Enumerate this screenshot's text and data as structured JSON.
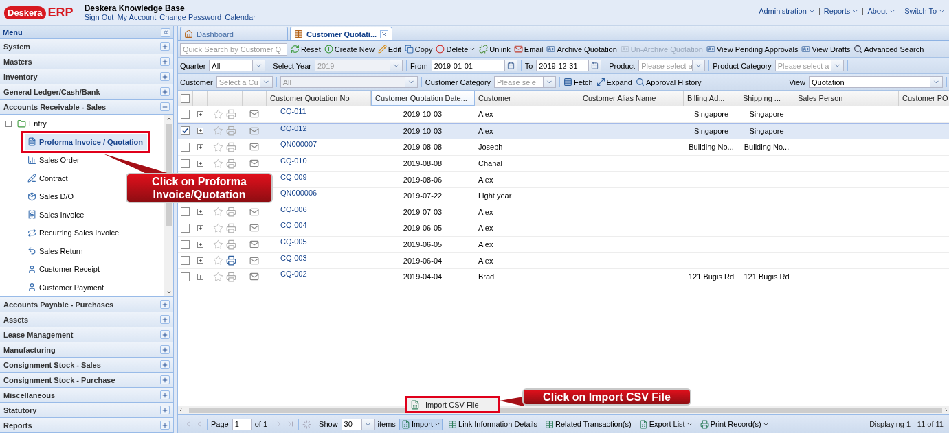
{
  "header": {
    "logo": {
      "word": "Deskera",
      "suffix": "ERP"
    },
    "title": "Deskera Knowledge Base",
    "links": [
      "Sign Out",
      "My Account",
      "Change Password",
      "Calendar"
    ],
    "menus": [
      {
        "label": "Administration"
      },
      {
        "label": "Reports"
      },
      {
        "label": "About"
      },
      {
        "label": "Switch To"
      }
    ]
  },
  "sidebar": {
    "title": "Menu",
    "sections": [
      {
        "label": "System",
        "expanded": false
      },
      {
        "label": "Masters",
        "expanded": false
      },
      {
        "label": "Inventory",
        "expanded": false
      },
      {
        "label": "General Ledger/Cash/Bank",
        "expanded": false
      },
      {
        "label": "Accounts Receivable - Sales",
        "expanded": true,
        "tree": [
          {
            "label": "Entry",
            "expanded": true,
            "children": [
              {
                "label": "Proforma Invoice / Quotation",
                "selected": true,
                "highlighted": true
              },
              {
                "label": "Sales Order",
                "selected": false,
                "highlighted": false
              },
              {
                "label": "Contract",
                "selected": false,
                "highlighted": false
              },
              {
                "label": "Sales D/O",
                "selected": false,
                "highlighted": false
              },
              {
                "label": "Sales Invoice",
                "selected": false,
                "highlighted": false
              },
              {
                "label": "Recurring Sales Invoice",
                "selected": false,
                "highlighted": false
              },
              {
                "label": "Sales Return",
                "selected": false,
                "highlighted": false
              },
              {
                "label": "Customer Receipt",
                "selected": false,
                "highlighted": false
              },
              {
                "label": "Customer Payment",
                "selected": false,
                "highlighted": false
              }
            ]
          }
        ]
      },
      {
        "label": "Accounts Payable - Purchases",
        "expanded": false
      },
      {
        "label": "Assets",
        "expanded": false
      },
      {
        "label": "Lease Management",
        "expanded": false
      },
      {
        "label": "Manufacturing",
        "expanded": false
      },
      {
        "label": "Consignment Stock - Sales",
        "expanded": false
      },
      {
        "label": "Consignment Stock - Purchase",
        "expanded": false
      },
      {
        "label": "Miscellaneous",
        "expanded": false
      },
      {
        "label": "Statutory",
        "expanded": false
      },
      {
        "label": "Reports",
        "expanded": false
      }
    ]
  },
  "tabs": [
    {
      "label": "Dashboard",
      "selected": false,
      "closable": false
    },
    {
      "label": "Customer Quotati...",
      "selected": true,
      "closable": true
    }
  ],
  "toolbar": {
    "search": {
      "placeholder": "Quick Search by Customer Q"
    },
    "buttons": [
      {
        "label": "Reset",
        "disabled": false,
        "dropdown": false
      },
      {
        "label": "Create New",
        "disabled": false,
        "dropdown": false
      },
      {
        "label": "Edit",
        "disabled": false,
        "dropdown": false
      },
      {
        "label": "Copy",
        "disabled": false,
        "dropdown": false
      },
      {
        "label": "Delete",
        "disabled": false,
        "dropdown": true
      },
      {
        "label": "Unlink",
        "disabled": false,
        "dropdown": false
      },
      {
        "label": "Email",
        "disabled": false,
        "dropdown": false
      },
      {
        "label": "Archive Quotation",
        "disabled": false,
        "dropdown": false
      },
      {
        "label": "Un-Archive Quotation",
        "disabled": true,
        "dropdown": false
      },
      {
        "label": "View Pending Approvals",
        "disabled": false,
        "dropdown": false
      },
      {
        "label": "View Drafts",
        "disabled": false,
        "dropdown": false
      },
      {
        "label": "Advanced Search",
        "disabled": false,
        "dropdown": false
      }
    ]
  },
  "filters": [
    [
      {
        "kind": "combo",
        "label": "Quarter",
        "value": "All",
        "disabled": false
      },
      {
        "kind": "combo",
        "label": "Select Year",
        "value": "2019",
        "disabled": true
      },
      {
        "kind": "date",
        "label": "From",
        "value": "2019-01-01",
        "disabled": false
      },
      {
        "kind": "date",
        "label": "To",
        "value": "2019-12-31",
        "disabled": false
      },
      {
        "kind": "combo",
        "label": "Product",
        "placeholder": "Please select a",
        "disabled": false
      },
      {
        "kind": "combo",
        "label": "Product Category",
        "placeholder": "Please select a",
        "disabled": false
      }
    ],
    [
      {
        "kind": "combo",
        "label": "Customer",
        "placeholder": "Select a Cu",
        "disabled": false
      },
      {
        "kind": "combo",
        "value": "All",
        "disabled": true
      },
      {
        "kind": "combo",
        "label": "Customer Category",
        "placeholder": "Please sele",
        "disabled": false
      },
      {
        "kind": "button",
        "label": "Fetch"
      },
      {
        "kind": "button",
        "label": "Expand"
      },
      {
        "kind": "button",
        "label": "Approval History"
      },
      {
        "kind": "combo",
        "label": "View",
        "value": "Quotation",
        "disabled": false
      }
    ]
  ],
  "grid": {
    "header_checked": false,
    "columns": [
      {
        "label": "Customer Quotation No",
        "sorted": false
      },
      {
        "label": "Customer Quotation Date...",
        "sorted": true
      },
      {
        "label": "Customer",
        "sorted": false
      },
      {
        "label": "Customer Alias Name",
        "sorted": false
      },
      {
        "label": "Billing Ad...",
        "sorted": false
      },
      {
        "label": "Shipping ...",
        "sorted": false
      },
      {
        "label": "Sales Person",
        "sorted": false
      },
      {
        "label": "Customer PO",
        "sorted": false
      }
    ],
    "rows": [
      {
        "no": "CQ-011",
        "date": "2019-10-03",
        "customer": "Alex",
        "billing": "Singapore",
        "shipping": "Singapore",
        "selected": false,
        "printed": false
      },
      {
        "no": "CQ-012",
        "date": "2019-10-03",
        "customer": "Alex",
        "billing": "Singapore",
        "shipping": "Singapore",
        "selected": true,
        "printed": false
      },
      {
        "no": "QN000007",
        "date": "2019-08-08",
        "customer": "Joseph",
        "billing": "Building No...",
        "shipping": "Building No...",
        "selected": false,
        "printed": false
      },
      {
        "no": "CQ-010",
        "date": "2019-08-08",
        "customer": "Chahal",
        "selected": false,
        "printed": false
      },
      {
        "no": "CQ-009",
        "date": "2019-08-06",
        "customer": "Alex",
        "selected": false
      },
      {
        "no": "QN000006",
        "date": "2019-07-22",
        "customer": "Light year",
        "selected": false
      },
      {
        "no": "CQ-006",
        "date": "2019-07-03",
        "customer": "Alex",
        "selected": false,
        "printed": false
      },
      {
        "no": "CQ-004",
        "date": "2019-06-05",
        "customer": "Alex",
        "selected": false,
        "printed": false
      },
      {
        "no": "CQ-005",
        "date": "2019-06-05",
        "customer": "Alex",
        "selected": false,
        "printed": false
      },
      {
        "no": "CQ-003",
        "date": "2019-06-04",
        "customer": "Alex",
        "selected": false,
        "printed": true
      },
      {
        "no": "CQ-002",
        "date": "2019-04-04",
        "customer": "Brad",
        "billing": "121 Bugis Rd",
        "shipping": "121 Bugis Rd",
        "selected": false,
        "printed": false
      }
    ]
  },
  "import_menu": [
    {
      "label": "Import CSV File",
      "highlighted": true
    }
  ],
  "paging": {
    "page_label": "Page",
    "page": "1",
    "of": "of 1",
    "show_label": "Show",
    "page_size": "30",
    "items_label": "items",
    "buttons": [
      {
        "label": "Import",
        "dropdown": true,
        "pressed": true
      },
      {
        "label": "Link Information Details",
        "dropdown": false,
        "pressed": false
      },
      {
        "label": "Related Transaction(s)",
        "dropdown": false,
        "pressed": false
      },
      {
        "label": "Export List",
        "dropdown": true,
        "pressed": false
      },
      {
        "label": "Print Record(s)",
        "dropdown": true,
        "pressed": false
      }
    ],
    "status": "Displaying 1 - 11 of 11"
  },
  "callouts": [
    {
      "kind": "tree",
      "text": "Click on Proforma Invoice/Quotation"
    },
    {
      "kind": "menu",
      "text": "Click on Import CSV File"
    }
  ]
}
